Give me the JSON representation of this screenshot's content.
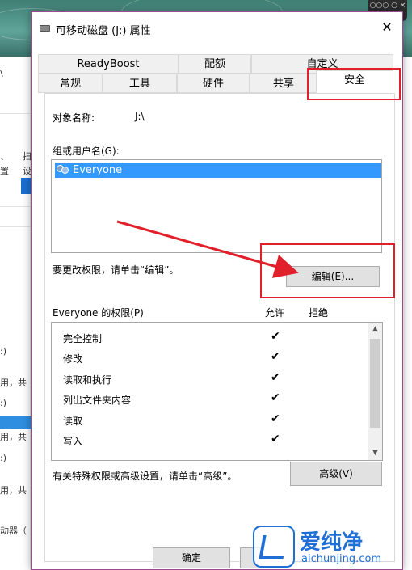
{
  "background": {
    "corner_chip_text": "○○○ ○ ×",
    "left_texts": [
      "\\",
      "扫",
      "设",
      "、",
      "置",
      ":)",
      "用，共",
      ":)",
      "用，共",
      ":)",
      "用，共",
      "动器（"
    ]
  },
  "dialog": {
    "title": "可移动磁盘 (J:) 属性",
    "close_label": "✕",
    "tabs_row1": [
      "ReadyBoost",
      "配额",
      "自定义"
    ],
    "tabs_row2": [
      "常规",
      "工具",
      "硬件",
      "共享",
      "安全"
    ],
    "active_tab": "安全",
    "object_name_label": "对象名称:",
    "object_name_value": "J:\\",
    "group_label": "组或用户名(G):",
    "users": [
      "Everyone"
    ],
    "change_perm_text": "要更改权限，请单击“编辑”。",
    "edit_button": "编辑(E)...",
    "perm_label": "Everyone 的权限(P)",
    "allow_header": "允许",
    "deny_header": "拒绝",
    "permissions": [
      {
        "name": "完全控制",
        "allow": "✔",
        "deny": ""
      },
      {
        "name": "修改",
        "allow": "✔",
        "deny": ""
      },
      {
        "name": "读取和执行",
        "allow": "✔",
        "deny": ""
      },
      {
        "name": "列出文件夹内容",
        "allow": "✔",
        "deny": ""
      },
      {
        "name": "读取",
        "allow": "✔",
        "deny": ""
      },
      {
        "name": "写入",
        "allow": "✔",
        "deny": ""
      }
    ],
    "advanced_text": "有关特殊权限或高级设置，请单击“高级”。",
    "advanced_button": "高级(V)",
    "ok_button": "确定"
  },
  "watermark": {
    "title": "爱纯净",
    "url": "aichunjing.com"
  },
  "colors": {
    "selection": "#3399ff",
    "annotation_red": "#e0202a",
    "watermark_blue": "#1f6fd6"
  }
}
